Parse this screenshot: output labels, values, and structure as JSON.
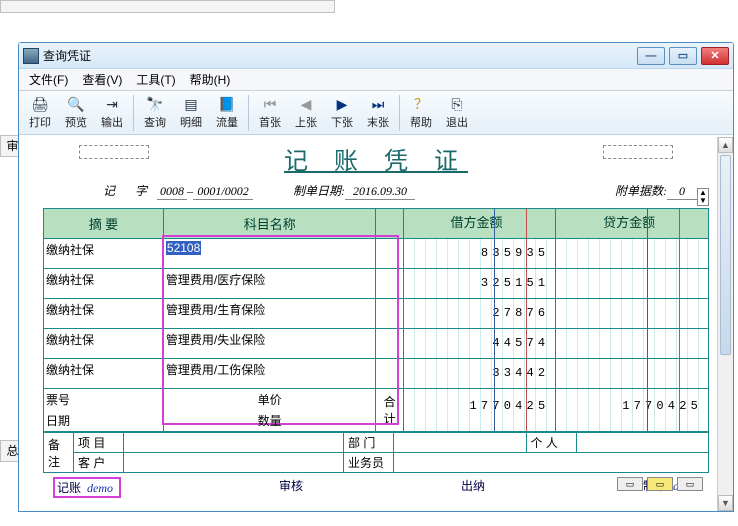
{
  "window": {
    "title": "查询凭证"
  },
  "menu": {
    "file": "文件(F)",
    "view": "查看(V)",
    "tools": "工具(T)",
    "help": "帮助(H)"
  },
  "toolbar": {
    "print": "打印",
    "preview": "预览",
    "export": "输出",
    "query": "查询",
    "detail": "明细",
    "flow": "流量",
    "first": "首张",
    "prev": "上张",
    "next": "下张",
    "last": "末张",
    "helpbtn": "帮助",
    "exit": "退出"
  },
  "voucher": {
    "title": "记 账 凭 证",
    "ji": "记",
    "zi": "字",
    "batch": "0008",
    "seq": "0001/0002",
    "date_label": "制单日期:",
    "date": "2016.09.30",
    "attach_label": "附单据数:",
    "attach": "0"
  },
  "headers": {
    "summary": "摘 要",
    "subject": "科目名称",
    "debit": "借方金额",
    "credit": "贷方金额"
  },
  "rows": [
    {
      "summary": "缴纳社保",
      "subject": "52108",
      "debit": "835935",
      "credit": "",
      "highlight": true
    },
    {
      "summary": "缴纳社保",
      "subject": "管理费用/医疗保险",
      "debit": "325151",
      "credit": ""
    },
    {
      "summary": "缴纳社保",
      "subject": "管理费用/生育保险",
      "debit": "27876",
      "credit": ""
    },
    {
      "summary": "缴纳社保",
      "subject": "管理费用/失业保险",
      "debit": "44574",
      "credit": ""
    },
    {
      "summary": "缴纳社保",
      "subject": "管理费用/工伤保险",
      "debit": "33442",
      "credit": ""
    }
  ],
  "footer": {
    "ticket": "票号",
    "date": "日期",
    "price": "单价",
    "qty": "数量",
    "total_label": "合 计",
    "debit_total": "1770425",
    "credit_total": "1770425",
    "remark": "备注",
    "project": "项 目",
    "customer": "客 户",
    "dept": "部 门",
    "sales": "业务员",
    "person": "个 人"
  },
  "sign": {
    "book": "记账",
    "book_val": "demo",
    "audit": "审核",
    "cashier": "出纳",
    "maker": "制单",
    "maker_val": "demo"
  },
  "frags": {
    "shen": "审",
    "zong": "总"
  }
}
